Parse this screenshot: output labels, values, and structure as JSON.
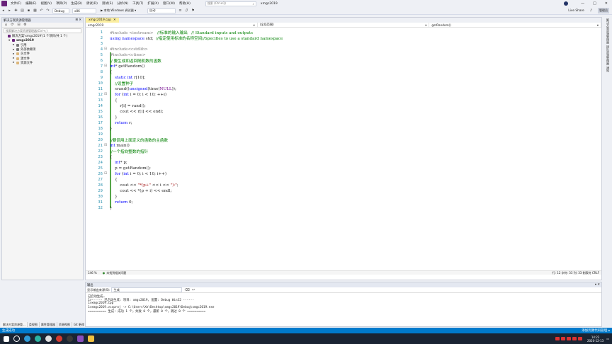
{
  "menubar": {
    "items": [
      "文件(F)",
      "编辑(E)",
      "视图(V)",
      "项目(P)",
      "生成(B)",
      "调试(D)",
      "测试(S)",
      "分析(N)",
      "工具(T)",
      "扩展(X)",
      "窗口(W)",
      "帮助(H)"
    ],
    "search_placeholder": "搜索 (Ctrl+Q)",
    "project_name": "xmgc2019",
    "live_share": "Live Share",
    "admin_badge": "管理员"
  },
  "toolbar": {
    "config": "Debug",
    "platform": "x86",
    "run_label": "▶ 本地 Windows 调试器 ▾",
    "run_mode": "自动"
  },
  "solution": {
    "title": "解决方案资源管理器",
    "search_placeholder": "搜索解决方案资源管理器(Ctrl+;)",
    "items": [
      {
        "label": "解决方案'xmgc2019'(1 个项目/共 1 个)",
        "indent": 0,
        "icon": "solution-icon"
      },
      {
        "label": "xmgc2019",
        "indent": 1,
        "icon": "project-icon"
      },
      {
        "label": "引用",
        "indent": 2,
        "icon": "references-icon"
      },
      {
        "label": "外部依赖项",
        "indent": 2,
        "icon": "external-deps-icon"
      },
      {
        "label": "头文件",
        "indent": 2,
        "icon": "folder-icon"
      },
      {
        "label": "源文件",
        "indent": 2,
        "icon": "folder-icon"
      },
      {
        "label": "资源文件",
        "indent": 2,
        "icon": "folder-icon"
      }
    ],
    "tabs": [
      "解决方案资源管...",
      "类视图",
      "属性管理器",
      "资源视图",
      "Git 更改"
    ]
  },
  "editor": {
    "tab_label": "xmgc2019.cpp",
    "nav_project": "xmgc2019",
    "nav_scope": "(全局范围)",
    "nav_function": "getRandom()",
    "zoom": "146 %",
    "issues": "未找到相关问题",
    "position": "行: 12    字符: 33    列: 33    制表符    CRLF",
    "lines": [
      "#include <iostream>   //标准的输入输出   // Standard inputs and outputs",
      "using namespace std;  //指定使用标准的名称空间//Specifies to use a standard namespace",
      "",
      "#include<cstdlib>",
      "#include<ctime>",
      "// 要生成和返回随机数的函数",
      "int* getRandom()",
      "{",
      "    static int r[10];",
      "    //设置种子",
      "    srand((unsigned)time(NULL));",
      "    for (int i = 0; i < 10; ++i)",
      "    {",
      "        r[i] = rand();",
      "        cout << r[i] << endl;",
      "    }",
      "    return r;",
      "}",
      "",
      "//要调用上面定义的函数的主函数",
      "int main()",
      "//一个指向整数的指针",
      "{",
      "    int* p;",
      "    p = getRandom();",
      "    for (int i = 0; i < 10; i++)",
      "    {",
      "        cout << \"*(p+\" << i << \"):\";",
      "        cout << *(p + i) << endl;",
      "    }",
      "    return 0;",
      "}"
    ]
  },
  "output": {
    "title": "输出",
    "source_label": "显示输出来源(S):",
    "source_value": "生成",
    "lines": [
      "已启动生成…",
      "1>------ 已启动生成: 项目: xmgc2019, 配置: Debug Win32 ------",
      "1>xmgc2019.cpp",
      "1>xmgc2019.vcxproj -> C:\\Users\\Xe\\Desktop\\xmgc2019\\Debug\\xmgc2019.exe",
      "========== 生成: 成功 1 个，失败 0 个，最新 0 个，跳过 0 个 =========="
    ]
  },
  "statusbar": {
    "left": "生成成功",
    "right": "添加到源代码管理 ▴"
  },
  "side_rail": {
    "labels": [
      "解决方案资源管理器",
      "团队资源管理器",
      "通知"
    ]
  },
  "taskbar": {
    "time": "14:23",
    "date": "2020-12-13"
  },
  "colors": {
    "accent": "#007acc",
    "keyword": "#0000ff",
    "comment": "#008000",
    "string": "#a31515",
    "preprocessor": "#808080"
  }
}
